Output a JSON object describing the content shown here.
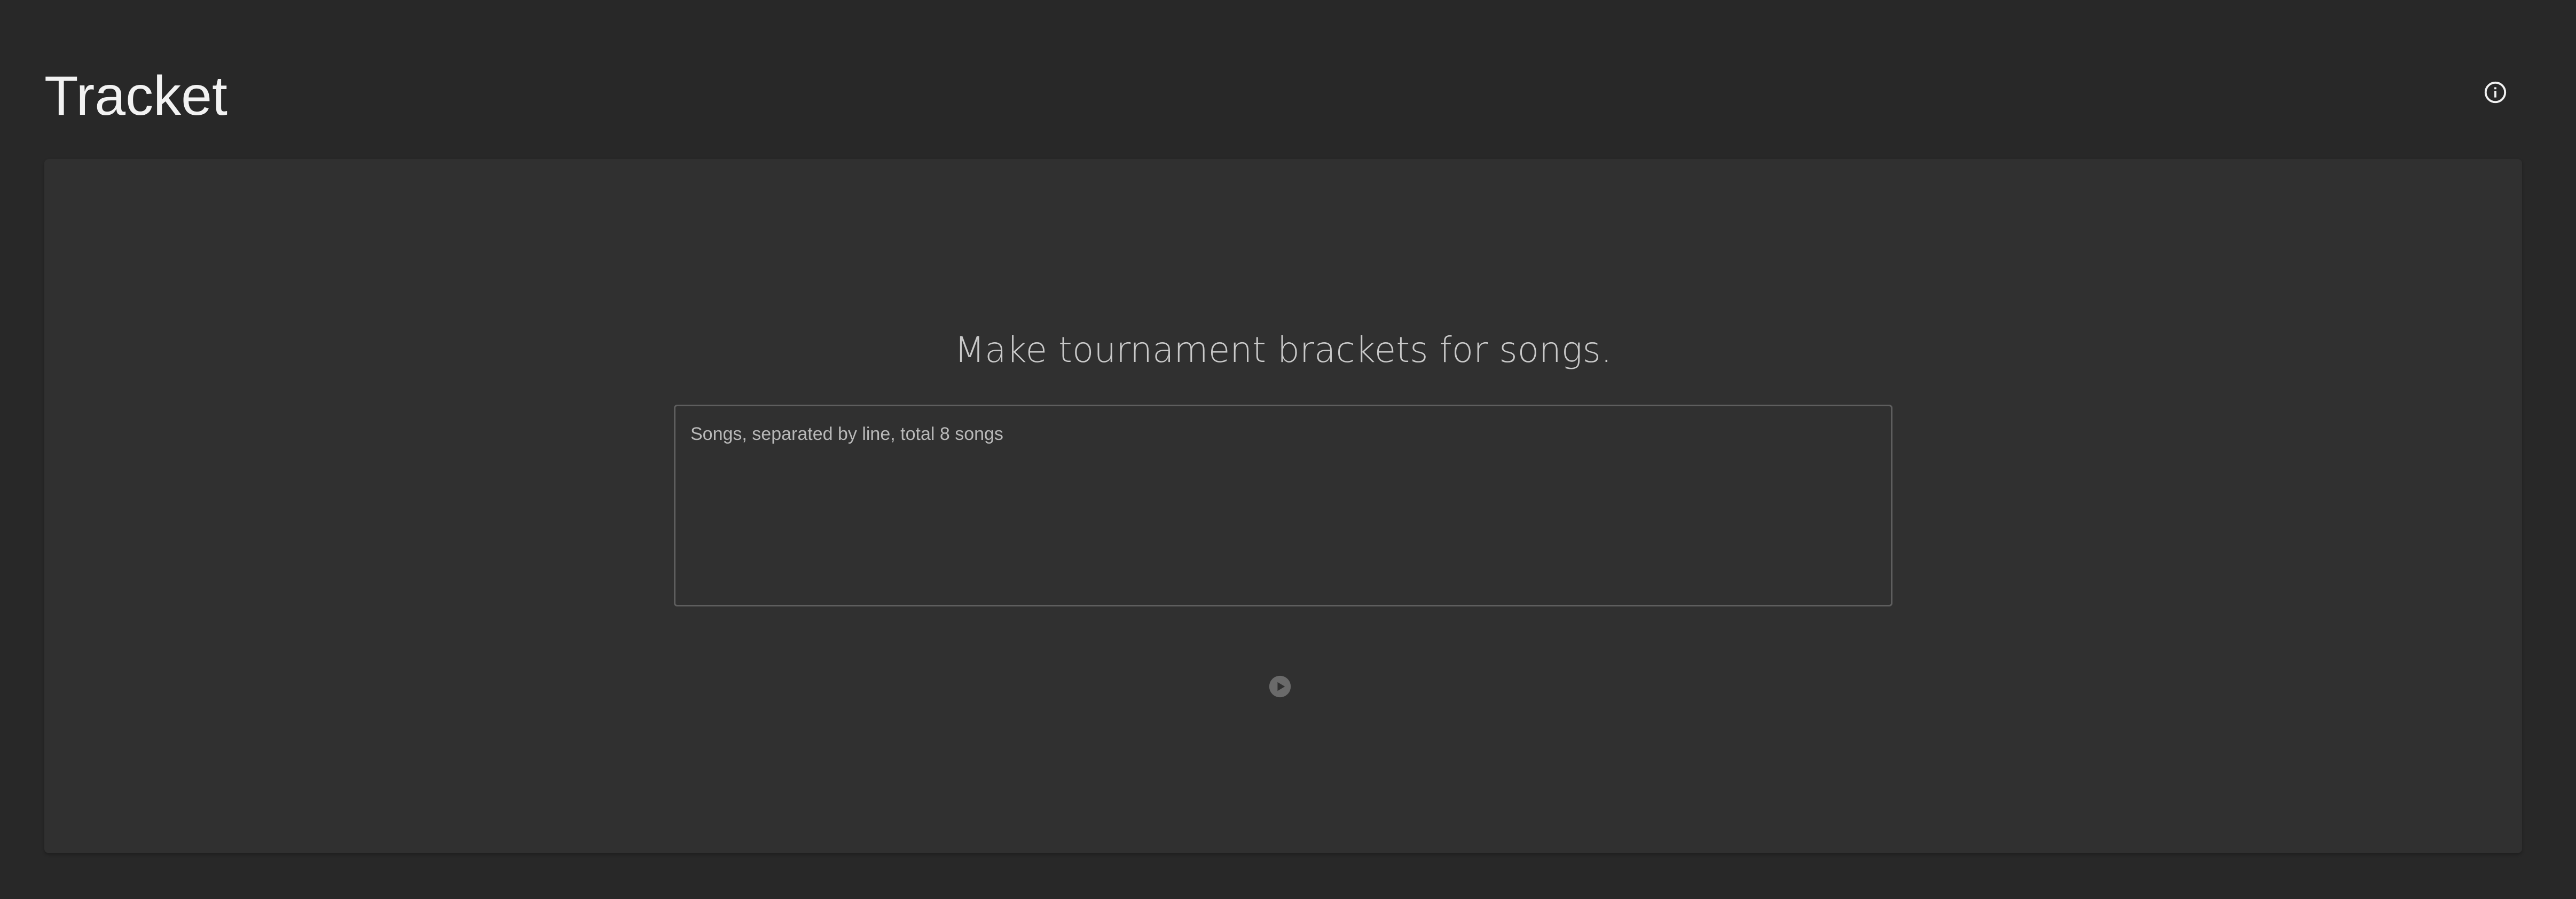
{
  "app": {
    "title": "Tracket"
  },
  "header": {
    "info_icon": "info-circle-icon"
  },
  "main": {
    "tagline": "Make tournament brackets for songs.",
    "songs_input": {
      "value": "",
      "placeholder": "Songs, separated by line, total 8 songs"
    },
    "start_icon": "play-circle-icon"
  },
  "colors": {
    "background": "#282828",
    "card": "#303030",
    "title_text": "#f2f2f2",
    "tagline_text": "#c9c9c9",
    "input_border": "#5e5e5e",
    "placeholder_text": "#b9b9b9",
    "play_icon": "#6a6a6a"
  }
}
